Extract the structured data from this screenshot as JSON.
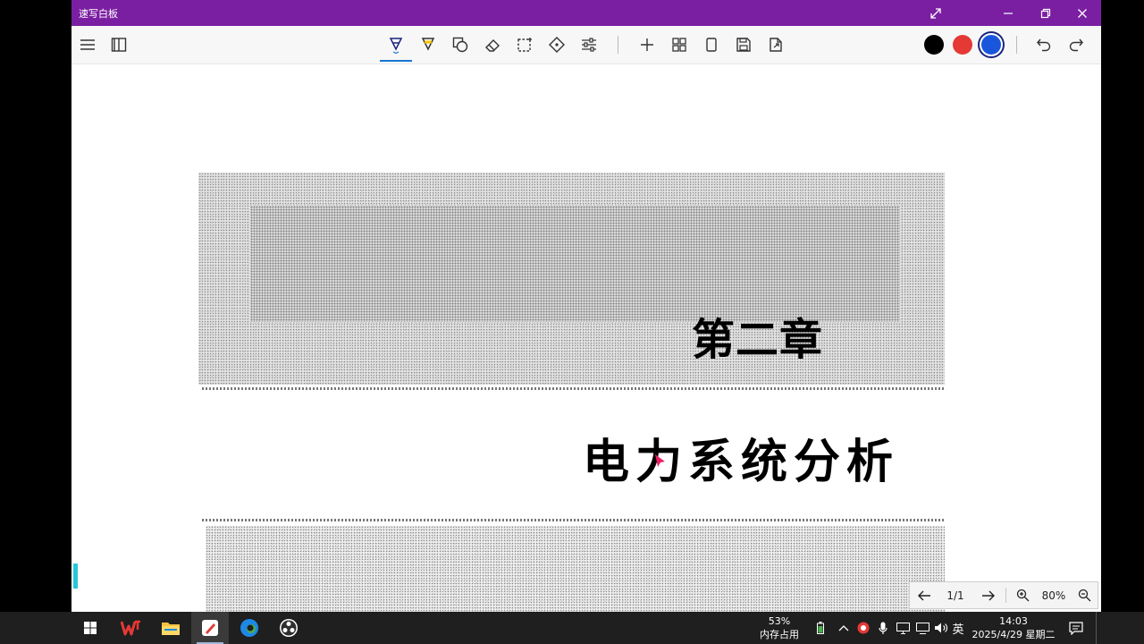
{
  "window": {
    "title": "速写白板"
  },
  "colors": {
    "title_bar": "#7b1fa2",
    "accent": "#1976d2",
    "swatch_black": "#000000",
    "swatch_red": "#e53935",
    "swatch_blue": "#1a56db"
  },
  "toolbar": {
    "icons_left": [
      "menu-icon",
      "book-icon"
    ],
    "tools": [
      "pen-icon",
      "highlighter-icon",
      "shapes-icon",
      "eraser-icon",
      "select-icon",
      "move-icon",
      "settings-sliders-icon"
    ],
    "actions": [
      "add-icon",
      "grid-icon",
      "page-icon",
      "save-icon",
      "export-icon"
    ],
    "history": [
      "undo-icon",
      "redo-icon"
    ]
  },
  "document": {
    "chapter": "第二章",
    "title": "电力系统分析"
  },
  "pagenav": {
    "page": "1/1",
    "zoom": "80%"
  },
  "taskbar": {
    "memory_percent": "53%",
    "memory_label": "内存占用",
    "ime": "英",
    "time": "14:03",
    "date": "2025/4/29 星期二"
  }
}
